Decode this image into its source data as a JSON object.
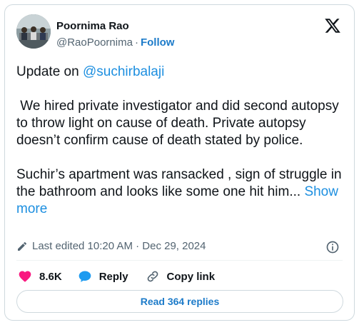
{
  "author": {
    "name": "Poornima Rao",
    "handle": "@RaoPoornima",
    "separator": "·",
    "follow_label": "Follow"
  },
  "tweet": {
    "line1_prefix": "Update on ",
    "mention": "@suchirbalaji",
    "paragraph2": " We hired private investigator and did second autopsy to throw light on cause of death. Private autopsy doesn’t confirm cause of death stated by police.",
    "paragraph3": "Suchir’s apartment was ransacked , sign of struggle in the bathroom and looks like some one hit him...",
    "show_more_label": "Show more"
  },
  "meta": {
    "edited_text": "Last edited 10:20 AM · Dec 29, 2024"
  },
  "actions": {
    "likes_count": "8.6K",
    "reply_label": "Reply",
    "copy_link_label": "Copy link"
  },
  "read_replies_label": "Read 364 replies",
  "colors": {
    "like": "#f91880",
    "reply": "#1d9bf0",
    "link": "#1d8fe0",
    "muted": "#536471",
    "border": "#cfd9de"
  },
  "icons": [
    "x-logo-icon",
    "pencil-icon",
    "info-icon",
    "heart-icon",
    "reply-bubble-icon",
    "link-icon"
  ]
}
